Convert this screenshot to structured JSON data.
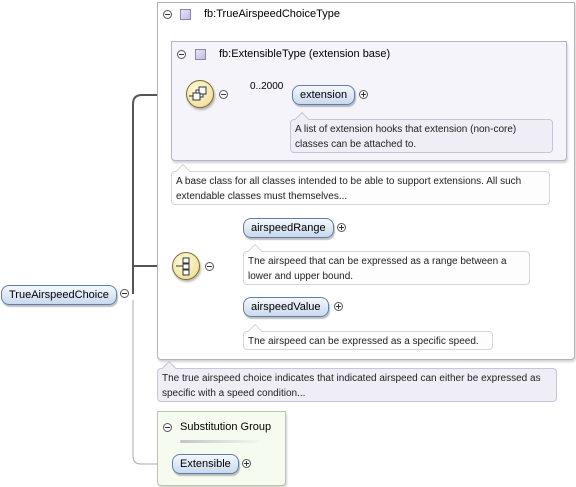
{
  "root": {
    "label": "TrueAirspeedChoice"
  },
  "type_frame": {
    "title": "fb:TrueAirspeedChoiceType",
    "base": {
      "title": "fb:ExtensibleType (extension base)",
      "occurrence": "0..2000",
      "element": "extension",
      "element_doc": "A list of extension hooks that extension (non-core) classes can be attached to."
    },
    "type_doc": "A base class for all classes intended to be able to support extensions. All such extendable classes must themselves...",
    "choice": {
      "items": [
        {
          "label": "airspeedRange",
          "doc": "The airspeed that can be expressed as a range between a lower and upper bound."
        },
        {
          "label": "airspeedValue",
          "doc": "The airspeed can be expressed as a specific speed."
        }
      ]
    }
  },
  "element_doc": "The true airspeed choice indicates that indicated airspeed can either be expressed as specific with a speed condition...",
  "substitution_group": {
    "title": "Substitution Group",
    "member": "Extensible"
  },
  "icons": {
    "sequence": "sequence-compositor-icon",
    "choice": "choice-compositor-icon",
    "type": "complex-type-icon"
  }
}
